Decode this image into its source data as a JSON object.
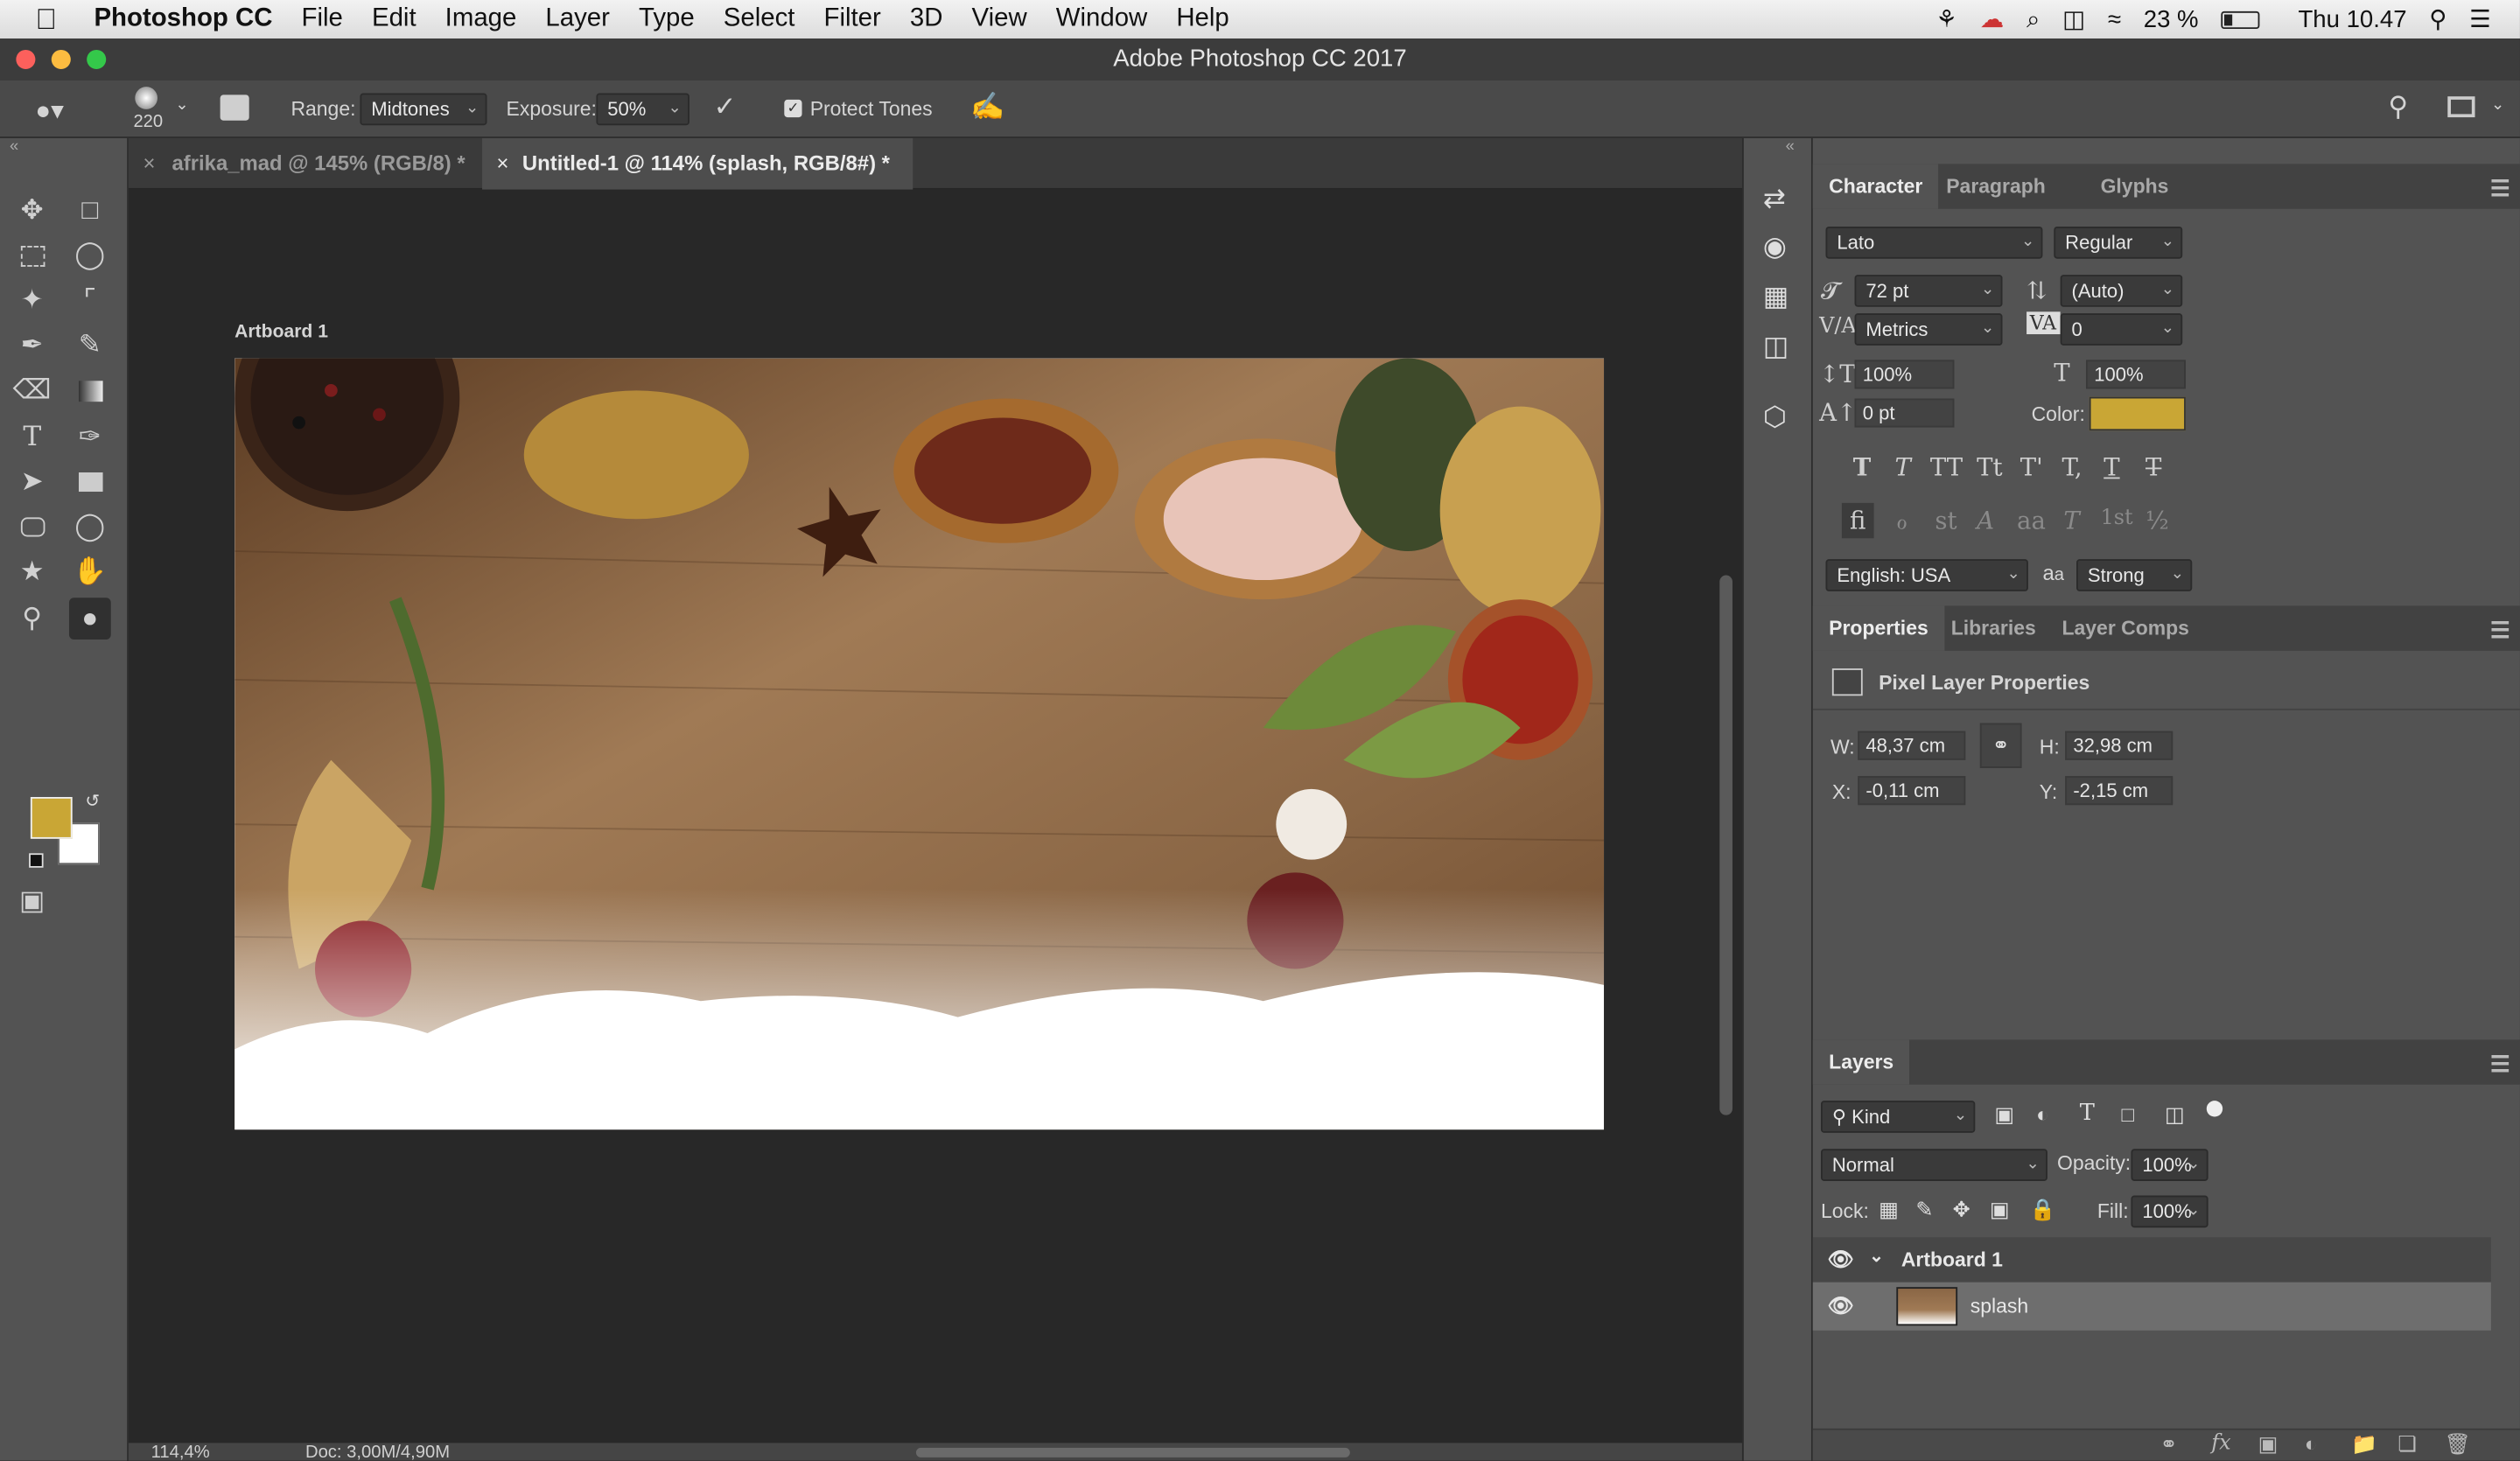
{
  "menubar": {
    "apple_icon": "apple-icon",
    "app_name": "Photoshop CC",
    "menus": [
      "File",
      "Edit",
      "Image",
      "Layer",
      "Type",
      "Select",
      "Filter",
      "3D",
      "View",
      "Window",
      "Help"
    ],
    "battery": "23 %",
    "clock": "Thu 10.47"
  },
  "window": {
    "title": "Adobe Photoshop CC 2017"
  },
  "options": {
    "brush_size": "220",
    "range_label": "Range:",
    "range_value": "Midtones",
    "exposure_label": "Exposure:",
    "exposure_value": "50%",
    "protect_tones": "Protect Tones"
  },
  "tabs": [
    {
      "label": "afrika_mad @ 145% (RGB/8) *",
      "active": false
    },
    {
      "label": "Untitled-1 @ 114% (splash, RGB/8#) *",
      "active": true
    }
  ],
  "canvas": {
    "artboard_label": "Artboard 1"
  },
  "colors": {
    "foreground": "#c9a635",
    "background": "#ffffff"
  },
  "character": {
    "tabs": [
      "Character",
      "Paragraph",
      "Glyphs"
    ],
    "font_family": "Lato",
    "font_style": "Regular",
    "size": "72 pt",
    "leading": "(Auto)",
    "kerning": "Metrics",
    "tracking": "0",
    "vscale": "100%",
    "hscale": "100%",
    "baseline": "0 pt",
    "color_label": "Color:",
    "language": "English: USA",
    "aa_label": "a",
    "antialias": "Strong",
    "style_buttons": [
      "T",
      "T",
      "TT",
      "Tt",
      "T'",
      "T,",
      "T",
      "T"
    ],
    "ot_buttons": [
      "fi",
      "ℴ",
      "st",
      "A",
      "aa",
      "T",
      "1st",
      "½"
    ]
  },
  "properties": {
    "tabs": [
      "Properties",
      "Libraries",
      "Layer Comps"
    ],
    "header": "Pixel Layer Properties",
    "w_label": "W:",
    "w": "48,37 cm",
    "h_label": "H:",
    "h": "32,98 cm",
    "x_label": "X:",
    "x": "-0,11 cm",
    "y_label": "Y:",
    "y": "-2,15 cm"
  },
  "layers": {
    "tab": "Layers",
    "filter_kind": "Kind",
    "blend_mode": "Normal",
    "opacity_label": "Opacity:",
    "opacity": "100%",
    "lock_label": "Lock:",
    "fill_label": "Fill:",
    "fill": "100%",
    "items": [
      {
        "name": "Artboard 1",
        "type": "group"
      },
      {
        "name": "splash",
        "type": "layer",
        "selected": true
      }
    ]
  },
  "status": {
    "zoom": "114,4%",
    "doc": "Doc: 3,00M/4,90M"
  }
}
